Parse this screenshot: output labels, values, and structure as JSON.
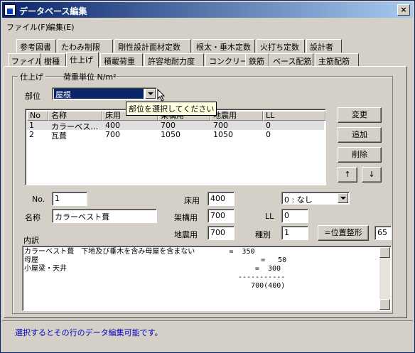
{
  "window": {
    "title": "データベース編集",
    "close_label": "×"
  },
  "menu": [
    {
      "label": "ファイル(F)"
    },
    {
      "label": "編集(E)"
    }
  ],
  "tabs_row1": [
    "参考図書",
    "たわみ制限",
    "剛性設計面材定数",
    "根太・垂木定数",
    "火打ち定数",
    "設計者"
  ],
  "tabs_row2": [
    "ファイル",
    "樹種",
    "仕上げ",
    "積載荷重",
    "許容地耐力度",
    "コンクリート",
    "鉄筋",
    "ベース配筋",
    "主筋配筋"
  ],
  "active_tab": "仕上げ",
  "group": {
    "title": "仕上げ",
    "unit_label": "荷重単位 N/m²"
  },
  "part": {
    "label": "部位",
    "value": "屋根",
    "tooltip": "部位を選択してください"
  },
  "grid": {
    "columns": [
      "No",
      "名称",
      "床用",
      "架構用",
      "地震用",
      "LL"
    ],
    "rows": [
      {
        "no": "1",
        "name": "カラーベス…",
        "floor": "400",
        "frame": "700",
        "quake": "700",
        "ll": "0"
      },
      {
        "no": "2",
        "name": "瓦葺",
        "floor": "700",
        "frame": "1050",
        "quake": "1050",
        "ll": "0"
      }
    ]
  },
  "buttons": {
    "change": "変更",
    "add": "追加",
    "delete": "削除",
    "up": "↑",
    "down": "↓",
    "align": "=位置整形"
  },
  "form": {
    "no_label": "No.",
    "no_value": "1",
    "name_label": "名称",
    "name_value": "カラーベスト葺",
    "floor_label": "床用",
    "floor_value": "400",
    "frame_label": "架構用",
    "frame_value": "700",
    "quake_label": "地震用",
    "quake_value": "700",
    "ll_label": "LL",
    "ll_value": "0",
    "type_label": "種別",
    "type_value": "1",
    "select_value": "0 : なし",
    "width_value": "65"
  },
  "breakdown": {
    "label": "内訳",
    "lines": [
      "カラーベスト葺　下地及び垂木を含み母屋を含まない        =  350",
      "母屋                                                    =   50",
      "小屋梁・天井                                            =  300",
      "                                                  -----------",
      "                                                     700(400)"
    ]
  },
  "status": "選択するとその行のデータ編集可能です。"
}
